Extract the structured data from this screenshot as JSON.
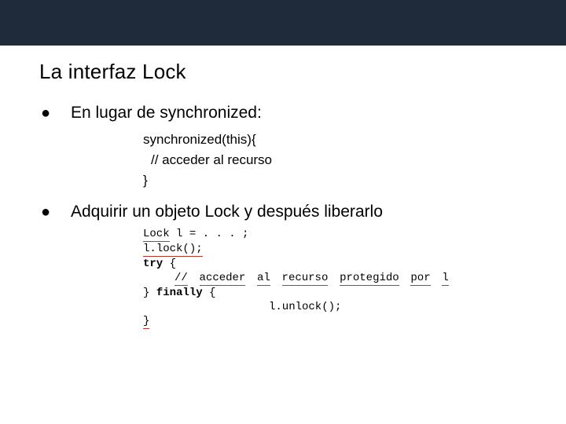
{
  "slide": {
    "title": "La interfaz Lock",
    "bullets": [
      {
        "text": "En lugar de synchronized:"
      },
      {
        "text": "Adquirir un objeto Lock y después liberarlo"
      }
    ],
    "snippet1": {
      "line1": "synchronized(this){",
      "line2": "// acceder al recurso",
      "line3": "}"
    },
    "snippet2": {
      "l1a": "Lock",
      "l1b": "l =",
      "l1c": ". . . ;",
      "l2a": "l.",
      "l2b": "lock",
      "l2c": "();",
      "l3a": "try",
      "l3b": " {",
      "l4a": "//",
      "l4b": "acceder",
      "l4c": "al",
      "l4d": "recurso",
      "l4e": "protegido",
      "l4f": "por",
      "l4g": "l",
      "l5a": "} ",
      "l5b": "finally",
      "l5c": " {",
      "l6": "l.unlock();",
      "l7": "}"
    }
  }
}
